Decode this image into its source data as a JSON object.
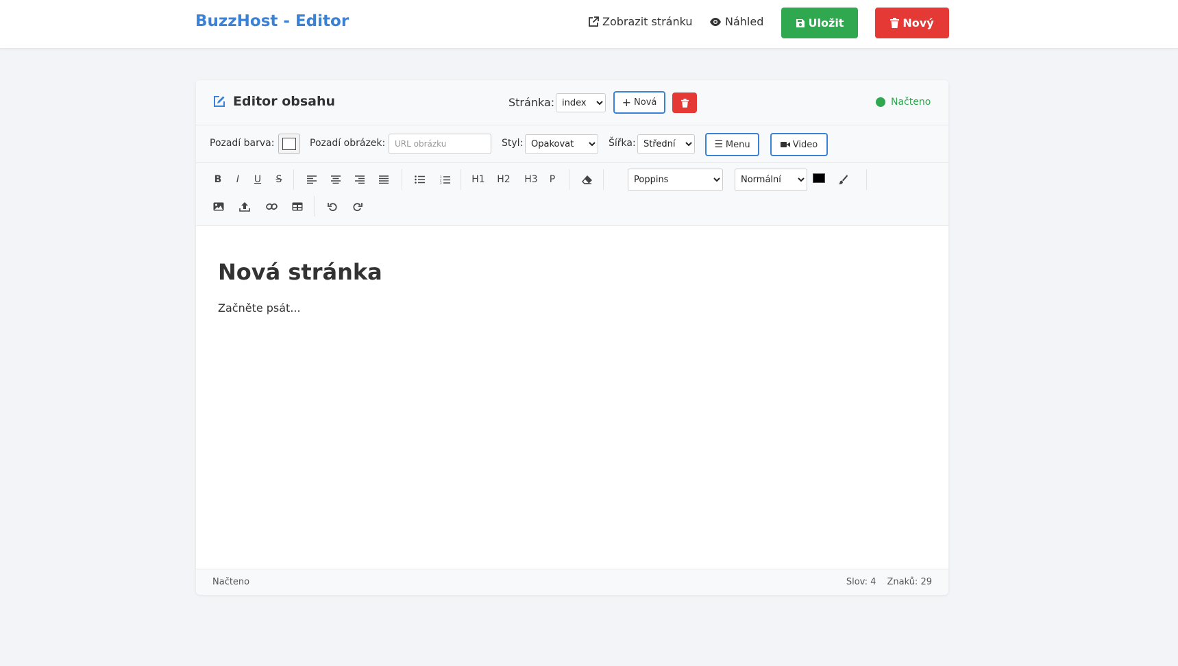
{
  "app": {
    "brand": "BuzzHost - Editor"
  },
  "topnav": {
    "view_page": "Zobrazit stránku",
    "preview": "Náhled",
    "save": "Uložit",
    "new": "Nový"
  },
  "editor_header": {
    "title": "Editor obsahu",
    "page_label": "Stránka:",
    "page_selected": "index",
    "new_page_button": "Nová",
    "status": "Načteno"
  },
  "options": {
    "bg_color_label": "Pozadí barva:",
    "bg_image_label": "Pozadí obrázek:",
    "bg_image_placeholder": "URL obrázku",
    "style_label": "Styl:",
    "style_selected": "Opakovat",
    "width_label": "Šířka:",
    "width_selected": "Střední",
    "menu_button": "Menu",
    "video_button": "Video"
  },
  "toolbar": {
    "bold": "B",
    "italic": "I",
    "underline": "U",
    "strike": "S",
    "h1": "H1",
    "h2": "H2",
    "h3": "H3",
    "p": "P",
    "font_selected": "Poppins",
    "size_selected": "Normální",
    "text_color": "#000000"
  },
  "document": {
    "heading": "Nová stránka",
    "paragraph": "Začněte psát..."
  },
  "footer": {
    "status": "Načteno",
    "words": "Slov: 4",
    "chars": "Znaků: 29"
  },
  "colors": {
    "brand": "#3b82d6",
    "success": "#2fa84f",
    "danger": "#e53935"
  }
}
